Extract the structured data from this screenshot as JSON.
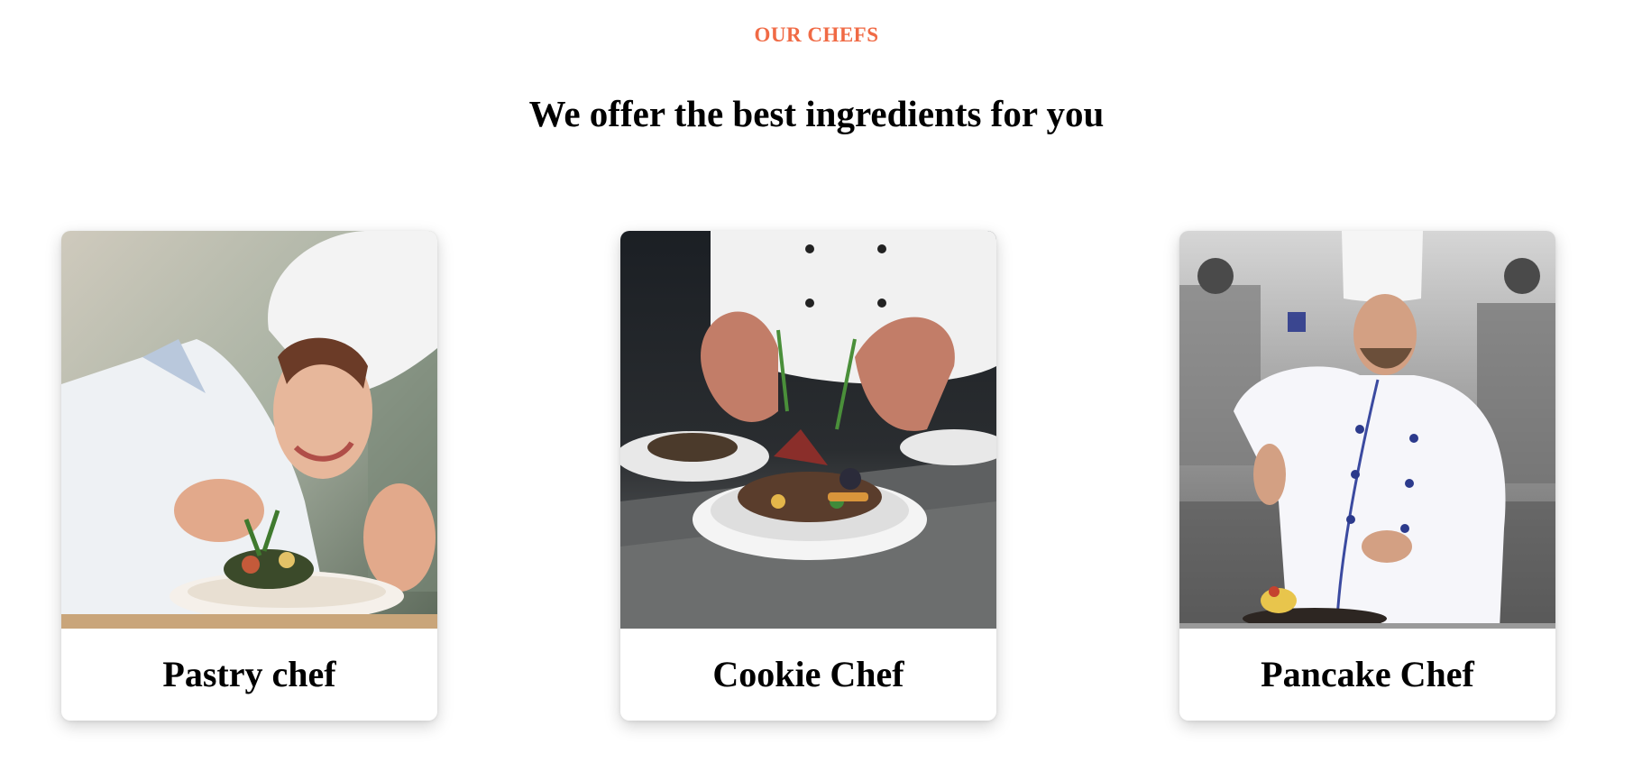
{
  "section": {
    "eyebrow": "OUR CHEFS",
    "heading": "We offer the best ingredients for you",
    "accent_color": "#f06a45"
  },
  "chefs": [
    {
      "name": "Pastry chef"
    },
    {
      "name": "Cookie Chef"
    },
    {
      "name": "Pancake Chef"
    }
  ]
}
